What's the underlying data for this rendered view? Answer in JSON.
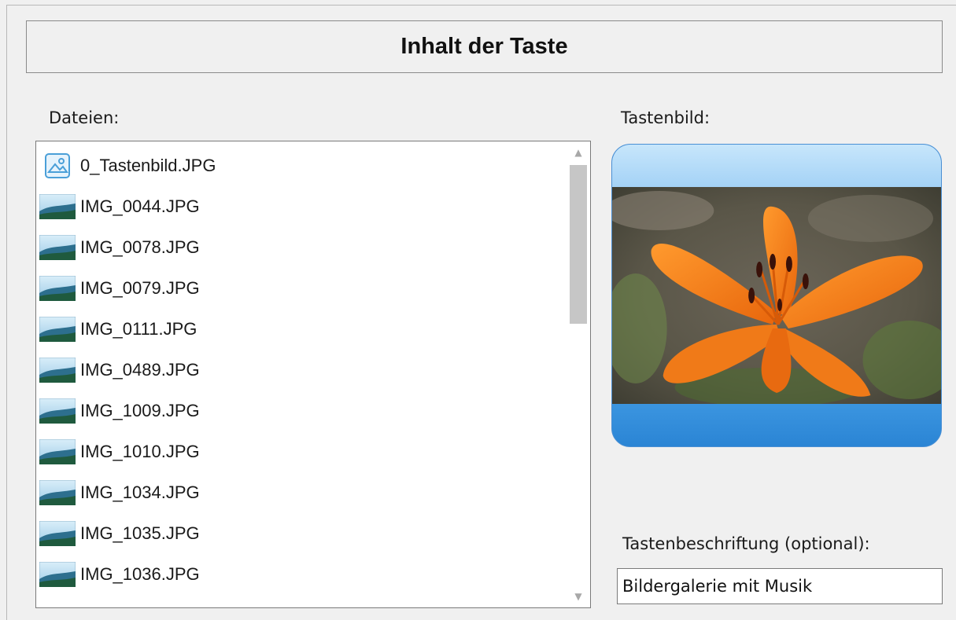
{
  "header": {
    "title": "Inhalt der Taste"
  },
  "files": {
    "label": "Dateien:",
    "items": [
      {
        "name": "0_Tastenbild.JPG",
        "icon": "button-image-icon"
      },
      {
        "name": "IMG_0044.JPG",
        "icon": "picture-file-icon"
      },
      {
        "name": "IMG_0078.JPG",
        "icon": "picture-file-icon"
      },
      {
        "name": "IMG_0079.JPG",
        "icon": "picture-file-icon"
      },
      {
        "name": "IMG_0111.JPG",
        "icon": "picture-file-icon"
      },
      {
        "name": "IMG_0489.JPG",
        "icon": "picture-file-icon"
      },
      {
        "name": "IMG_1009.JPG",
        "icon": "picture-file-icon"
      },
      {
        "name": "IMG_1010.JPG",
        "icon": "picture-file-icon"
      },
      {
        "name": "IMG_1034.JPG",
        "icon": "picture-file-icon"
      },
      {
        "name": "IMG_1035.JPG",
        "icon": "picture-file-icon"
      },
      {
        "name": "IMG_1036.JPG",
        "icon": "picture-file-icon"
      }
    ]
  },
  "preview": {
    "label": "Tastenbild:",
    "image": "orange-lily-photo"
  },
  "caption": {
    "label": "Tastenbeschriftung (optional):",
    "value": "Bildergalerie mit Musik"
  },
  "colors": {
    "button_top": "#a4d2f6",
    "button_bottom": "#2a84d4",
    "flower": "#f5821f"
  }
}
